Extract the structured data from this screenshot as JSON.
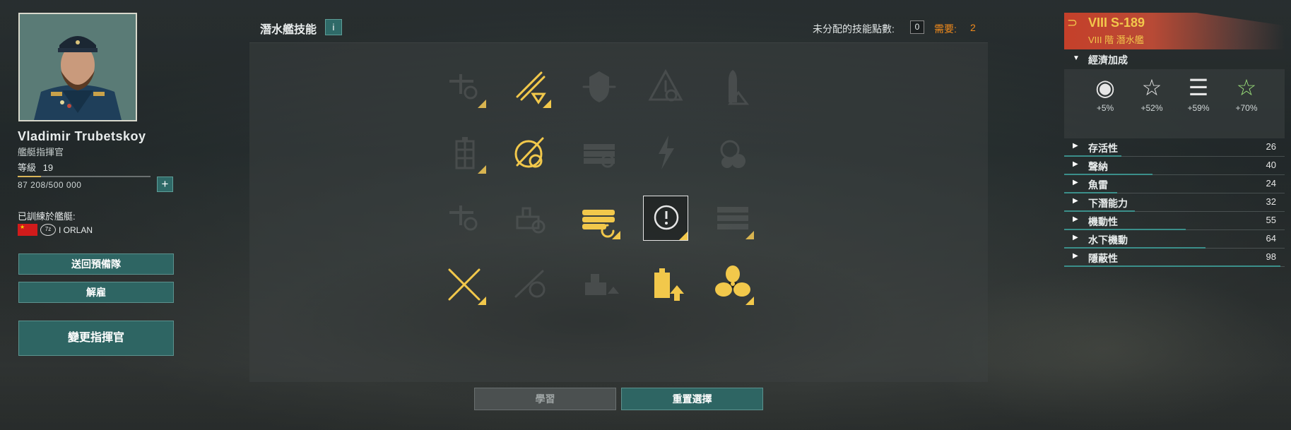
{
  "commander": {
    "name": "Vladimir  Trubetskoy",
    "role": "艦艇指揮官",
    "level_label": "等級",
    "level": "19",
    "xp_text": "87 208/500 000",
    "xp_progress": 0.174,
    "add_label": "+",
    "trained_label": "已訓練於艦艇:",
    "trained_ship": "I  ORLAN",
    "ship_badge": "7z",
    "buttons": {
      "reserve": "送回預備隊",
      "dismiss": "解雇",
      "change": "變更指揮官"
    }
  },
  "skills": {
    "title": "潛水艦技能",
    "info_label": "i",
    "unassigned_label": "未分配的技能點數:",
    "unassigned_value": "0",
    "need_label": "需要:",
    "need_value": "2",
    "learn_button": "學習",
    "reset_button": "重置選擇",
    "grid": [
      [
        {
          "icon": "periscope-icon",
          "state": "dim",
          "corner": true
        },
        {
          "icon": "torpedo-reload-icon",
          "state": "active",
          "corner": true
        },
        {
          "icon": "shield-anchor-icon",
          "state": "dim",
          "corner": false
        },
        {
          "icon": "warning-target-icon",
          "state": "dim",
          "corner": false
        },
        {
          "icon": "shell-warning-icon",
          "state": "dim",
          "corner": false
        }
      ],
      [
        {
          "icon": "battery-grid-icon",
          "state": "dim",
          "corner": true
        },
        {
          "icon": "torpedo-target-icon",
          "state": "active",
          "corner": false
        },
        {
          "icon": "torpedo-tubes-icon",
          "state": "dim",
          "corner": false
        },
        {
          "icon": "lightning-icon",
          "state": "dim",
          "corner": false
        },
        {
          "icon": "helm-icon",
          "state": "dim",
          "corner": false
        }
      ],
      [
        {
          "icon": "periscope-icon",
          "state": "dim",
          "corner": false
        },
        {
          "icon": "ship-target-icon",
          "state": "dim",
          "corner": false
        },
        {
          "icon": "torpedo-tubes-reload-icon",
          "state": "active",
          "corner": true
        },
        {
          "icon": "alert-circle-icon",
          "state": "selected",
          "corner": true
        },
        {
          "icon": "torpedo-rack-icon",
          "state": "dim",
          "corner": true
        }
      ],
      [
        {
          "icon": "crossed-torpedoes-icon",
          "state": "active",
          "corner": true
        },
        {
          "icon": "torpedo-gear-icon",
          "state": "dim",
          "corner": false
        },
        {
          "icon": "ship-upgrade-icon",
          "state": "dim",
          "corner": false
        },
        {
          "icon": "battery-upgrade-icon",
          "state": "active",
          "corner": false
        },
        {
          "icon": "propeller-icon",
          "state": "active",
          "corner": true
        }
      ]
    ]
  },
  "ship": {
    "tier_name": "VIII  S-189",
    "subtitle": "VIII 階  潛水艦",
    "economy_label": "經濟加成",
    "bonuses": [
      {
        "icon": "credits-icon",
        "glyph": "◉",
        "value": "+5%"
      },
      {
        "icon": "star-icon",
        "glyph": "☆",
        "value": "+52%"
      },
      {
        "icon": "commander-xp-icon",
        "glyph": "☰",
        "value": "+59%"
      },
      {
        "icon": "free-xp-icon",
        "glyph": "☆",
        "value": "+70%"
      }
    ],
    "stats": [
      {
        "label": "存活性",
        "value": "26",
        "progress": 0.26
      },
      {
        "label": "聲納",
        "value": "40",
        "progress": 0.4
      },
      {
        "label": "魚雷",
        "value": "24",
        "progress": 0.24
      },
      {
        "label": "下潛能力",
        "value": "32",
        "progress": 0.32
      },
      {
        "label": "機動性",
        "value": "55",
        "progress": 0.55
      },
      {
        "label": "水下機動",
        "value": "64",
        "progress": 0.64
      },
      {
        "label": "隱蔽性",
        "value": "98",
        "progress": 0.98
      }
    ],
    "colors": {
      "accent": "#f2c84b",
      "teal": "#2e6563",
      "need": "#f08a1c",
      "skill_active": "#f2c84b",
      "skill_dim": "#5a5e5e"
    }
  }
}
